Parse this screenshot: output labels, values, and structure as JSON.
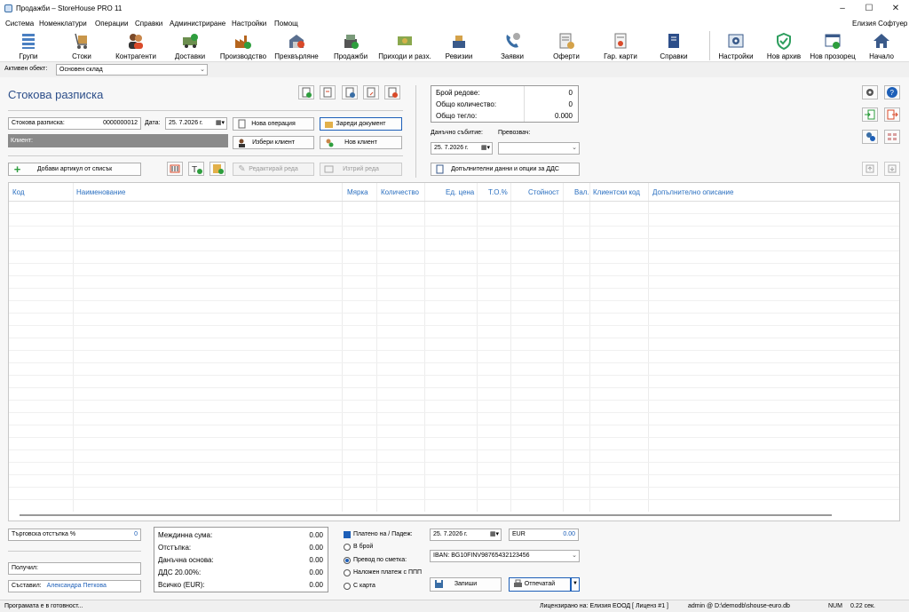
{
  "window": {
    "title": "Продажби – StoreHouse PRO 11",
    "minimize": "–",
    "maximize": "☐",
    "close": "✕"
  },
  "menu": {
    "items": [
      "Система",
      "Номенклатури",
      "Операции",
      "Справки",
      "Администриране",
      "Настройки",
      "Помощ"
    ],
    "company": "Елизия Софтуер"
  },
  "toolbar": {
    "items": [
      {
        "label": "Групи",
        "icon": "groups-icon"
      },
      {
        "label": "Стоки",
        "icon": "goods-icon"
      },
      {
        "label": "Контрагенти",
        "icon": "contacts-icon"
      },
      {
        "label": "Доставки",
        "icon": "delivery-icon"
      },
      {
        "label": "Производство",
        "icon": "factory-icon"
      },
      {
        "label": "Прехвърляне",
        "icon": "transfer-icon"
      },
      {
        "label": "Продажби",
        "icon": "cash-register-icon"
      },
      {
        "label": "Приходи и разх.",
        "icon": "money-icon"
      },
      {
        "label": "Ревизии",
        "icon": "scale-icon"
      },
      {
        "label": "Заявки",
        "icon": "phone-icon"
      },
      {
        "label": "Оферти",
        "icon": "offer-icon"
      },
      {
        "label": "Гар. карти",
        "icon": "warranty-icon"
      },
      {
        "label": "Справки",
        "icon": "report-book-icon"
      },
      {
        "label": "Настройки",
        "icon": "settings-icon"
      },
      {
        "label": "Нов архив",
        "icon": "shield-icon"
      },
      {
        "label": "Нов прозорец",
        "icon": "new-window-icon"
      },
      {
        "label": "Начало",
        "icon": "home-icon"
      }
    ]
  },
  "object": {
    "label": "Активен обект:",
    "value": "Основен склад"
  },
  "doc": {
    "title": "Стокова разписка",
    "number_label": "Стокова разписка:",
    "number": "0000000012",
    "date_label": "Дата:",
    "date": "25.  7.2026 г.",
    "client_label": "Клиент:",
    "new_operation": "Нова операция",
    "load_document": "Зареди документ",
    "choose_client": "Избери клиент",
    "new_client": "Нов клиент",
    "add_item": "Добави артикул от списък",
    "edit_row": "Редактирай реда",
    "delete_row": "Изтрий реда"
  },
  "stats": {
    "rows_label": "Брой редове:",
    "rows": "0",
    "qty_label": "Общо количество:",
    "qty": "0",
    "weight_label": "Общо тегло:",
    "weight": "0.000"
  },
  "tax": {
    "event_label": "Данъчно събитие:",
    "event_date": "25.  7.2026 г.",
    "carrier_label": "Превозвач:",
    "carrier": "",
    "extra_btn": "Допълнителни данни и опции за ДДС"
  },
  "grid": {
    "columns": [
      "Код",
      "Наименование",
      "Мярка",
      "Количество",
      "Ед. цена",
      "Т.О.%",
      "Стойност",
      "Вал.",
      "Клиентски код",
      "Допълнително описание"
    ]
  },
  "footer": {
    "discount_label": "Търговска отстъпка %",
    "discount": "0",
    "received_label": "Получил:",
    "composed_label": "Съставил:",
    "composed": "Александра Петкова",
    "subtotal_label": "Междинна сума:",
    "subtotal": "0.00",
    "disc_label": "Отстъпка:",
    "disc": "0.00",
    "base_label": "Данъчна основа:",
    "base": "0.00",
    "vat_label": "ДДС 20.00%:",
    "vat": "0.00",
    "total_label": "Всичко (EUR):",
    "total": "0.00",
    "paid_label": "Платено на / Падеж:",
    "pay_cash": "В брой",
    "pay_bank": "Превод по сметка:",
    "pay_cod": "Наложен платеж с ППП",
    "pay_card": "С карта",
    "paid_date": "25.  7.2026 г.",
    "currency": "EUR",
    "amount": "0.00",
    "iban": "IBAN: BG10FINV98765432123456",
    "save": "Запиши",
    "print": "Отпечатай"
  },
  "status": {
    "ready": "Програмата е в готовност...",
    "license": "Лицензирано на: Елизия ЕООД [ Лиценз #1 ]",
    "db": "admin @ D:\\demodb\\shouse-euro.db",
    "num": "NUM",
    "time": "0.22 сек."
  }
}
